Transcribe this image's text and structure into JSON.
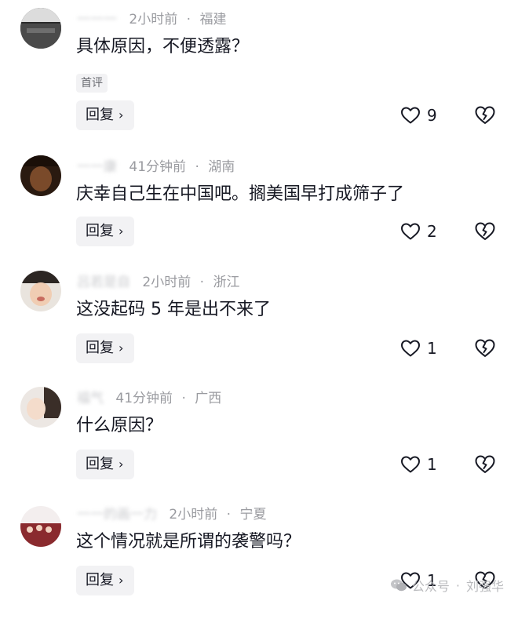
{
  "comments": [
    {
      "user": "一一一",
      "time": "2小时前",
      "location": "福建",
      "text": "具体原因，不便透露？",
      "tag": "首评",
      "reply_label": "回复",
      "likes": "9"
    },
    {
      "user": "一一康",
      "time": "41分钟前",
      "location": "湖南",
      "text": "庆幸自己生在中国吧。搁美国早打成筛子了",
      "tag": "",
      "reply_label": "回复",
      "likes": "2"
    },
    {
      "user": "吕若是自",
      "time": "2小时前",
      "location": "浙江",
      "text": "这没起码 5 年是出不来了",
      "tag": "",
      "reply_label": "回复",
      "likes": "1"
    },
    {
      "user": "福气",
      "time": "41分钟前",
      "location": "广西",
      "text": "什么原因？",
      "tag": "",
      "reply_label": "回复",
      "likes": "1"
    },
    {
      "user": "一一的画一力",
      "time": "2小时前",
      "location": "宁夏",
      "text": "这个情况就是所谓的袭警吗？",
      "tag": "",
      "reply_label": "回复",
      "likes": "1"
    }
  ],
  "watermark": {
    "platform": "公众号",
    "author": "刘强华"
  },
  "colors": {
    "text": "#161823",
    "meta": "#9a9ba0",
    "button_bg": "#f2f2f4"
  },
  "icons": {
    "like": "heart-icon",
    "dislike": "broken-heart-icon",
    "reply_arrow": "chevron-right-icon",
    "watermark": "wechat-icon"
  }
}
